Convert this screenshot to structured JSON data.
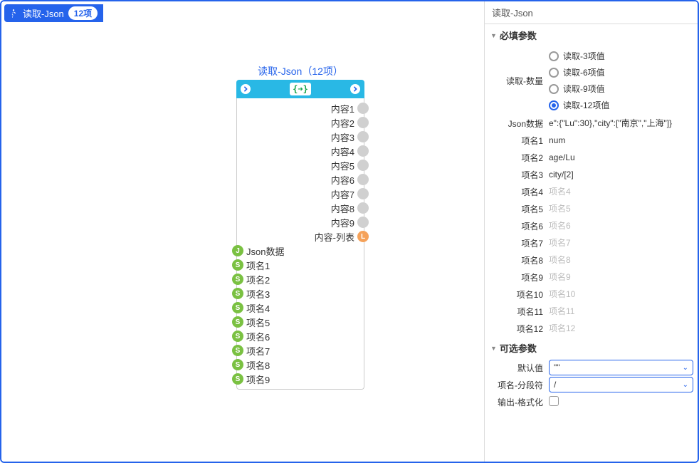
{
  "header": {
    "title": "读取-Json",
    "count": "12项"
  },
  "node": {
    "title": "读取-Json（12项）",
    "icon_text": "{➜}",
    "outputs": [
      "内容1",
      "内容2",
      "内容3",
      "内容4",
      "内容5",
      "内容6",
      "内容7",
      "内容8",
      "内容9"
    ],
    "output_list_label": "内容-列表",
    "input_json_label": "Json数据",
    "input_names": [
      "项名1",
      "项名2",
      "项名3",
      "项名4",
      "项名5",
      "项名6",
      "项名7",
      "项名8",
      "项名9"
    ]
  },
  "props": {
    "tab": "读取-Json",
    "required_header": "必填参数",
    "optional_header": "可选参数",
    "read_count_label": "读取-数量",
    "read_count_options": [
      "读取-3项值",
      "读取-6项值",
      "读取-9项值",
      "读取-12项值"
    ],
    "read_count_selected_index": 3,
    "json_data_label": "Json数据",
    "json_data_value": "e\":{\"Lu\":30},\"city\":[\"南京\",\"上海\"]}",
    "name_fields": [
      {
        "label": "项名1",
        "value": "num",
        "placeholder": ""
      },
      {
        "label": "项名2",
        "value": "age/Lu",
        "placeholder": ""
      },
      {
        "label": "项名3",
        "value": "city/[2]",
        "placeholder": ""
      },
      {
        "label": "项名4",
        "value": "",
        "placeholder": "项名4"
      },
      {
        "label": "项名5",
        "value": "",
        "placeholder": "项名5"
      },
      {
        "label": "项名6",
        "value": "",
        "placeholder": "项名6"
      },
      {
        "label": "项名7",
        "value": "",
        "placeholder": "项名7"
      },
      {
        "label": "项名8",
        "value": "",
        "placeholder": "项名8"
      },
      {
        "label": "项名9",
        "value": "",
        "placeholder": "项名9"
      },
      {
        "label": "项名10",
        "value": "",
        "placeholder": "项名10"
      },
      {
        "label": "项名11",
        "value": "",
        "placeholder": "项名11"
      },
      {
        "label": "项名12",
        "value": "",
        "placeholder": "项名12"
      }
    ],
    "default_label": "默认值",
    "default_value": "\"\"",
    "delimiter_label": "项名-分段符",
    "delimiter_value": "/",
    "format_label": "输出-格式化",
    "format_checked": false
  }
}
